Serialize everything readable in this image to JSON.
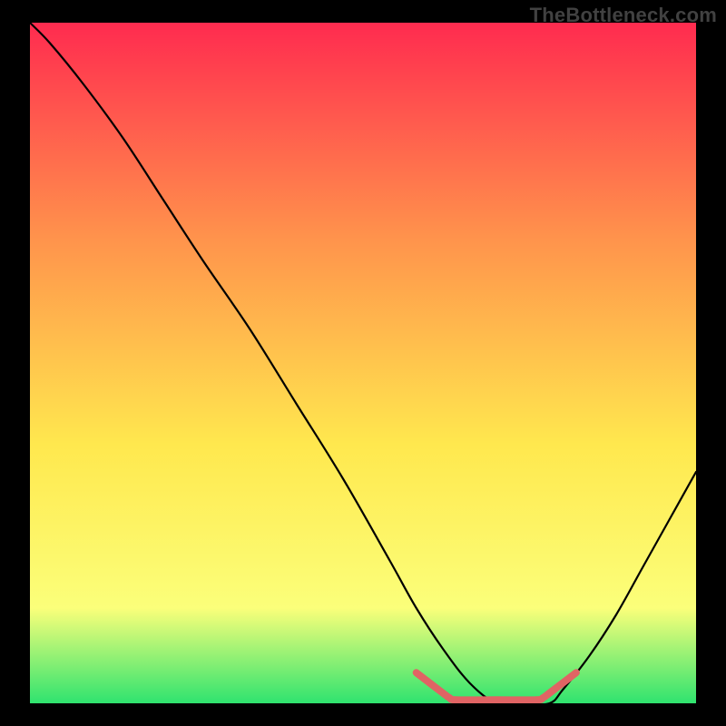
{
  "watermark": "TheBottleneck.com",
  "chart_data": {
    "type": "line",
    "title": "",
    "xlabel": "",
    "ylabel": "",
    "xlim": [
      0,
      100
    ],
    "ylim": [
      0,
      100
    ],
    "grid": false,
    "legend": false,
    "background_gradient": {
      "top": "#ff2b4f",
      "mid_upper": "#ff944c",
      "mid": "#ffe84e",
      "lower": "#fbff7a",
      "bottom": "#2fe36f"
    },
    "series": [
      {
        "name": "primary-curve",
        "color": "#000000",
        "x": [
          0,
          3,
          8,
          14,
          20,
          26,
          33,
          40,
          47,
          54,
          58,
          62,
          66,
          70,
          74,
          78,
          80,
          84,
          88,
          92,
          96,
          100
        ],
        "values": [
          100,
          97,
          91,
          83,
          74,
          65,
          55,
          44,
          33,
          21,
          14,
          8,
          3,
          0,
          0,
          0,
          2,
          7,
          13,
          20,
          27,
          34
        ]
      },
      {
        "name": "bottom-highlight",
        "color": "#e06464",
        "x": [
          58,
          62,
          63,
          64,
          70,
          76,
          77,
          78,
          82
        ],
        "values": [
          4.5,
          1.5,
          0.8,
          0.5,
          0.5,
          0.5,
          0.8,
          1.5,
          4.5
        ]
      }
    ]
  }
}
